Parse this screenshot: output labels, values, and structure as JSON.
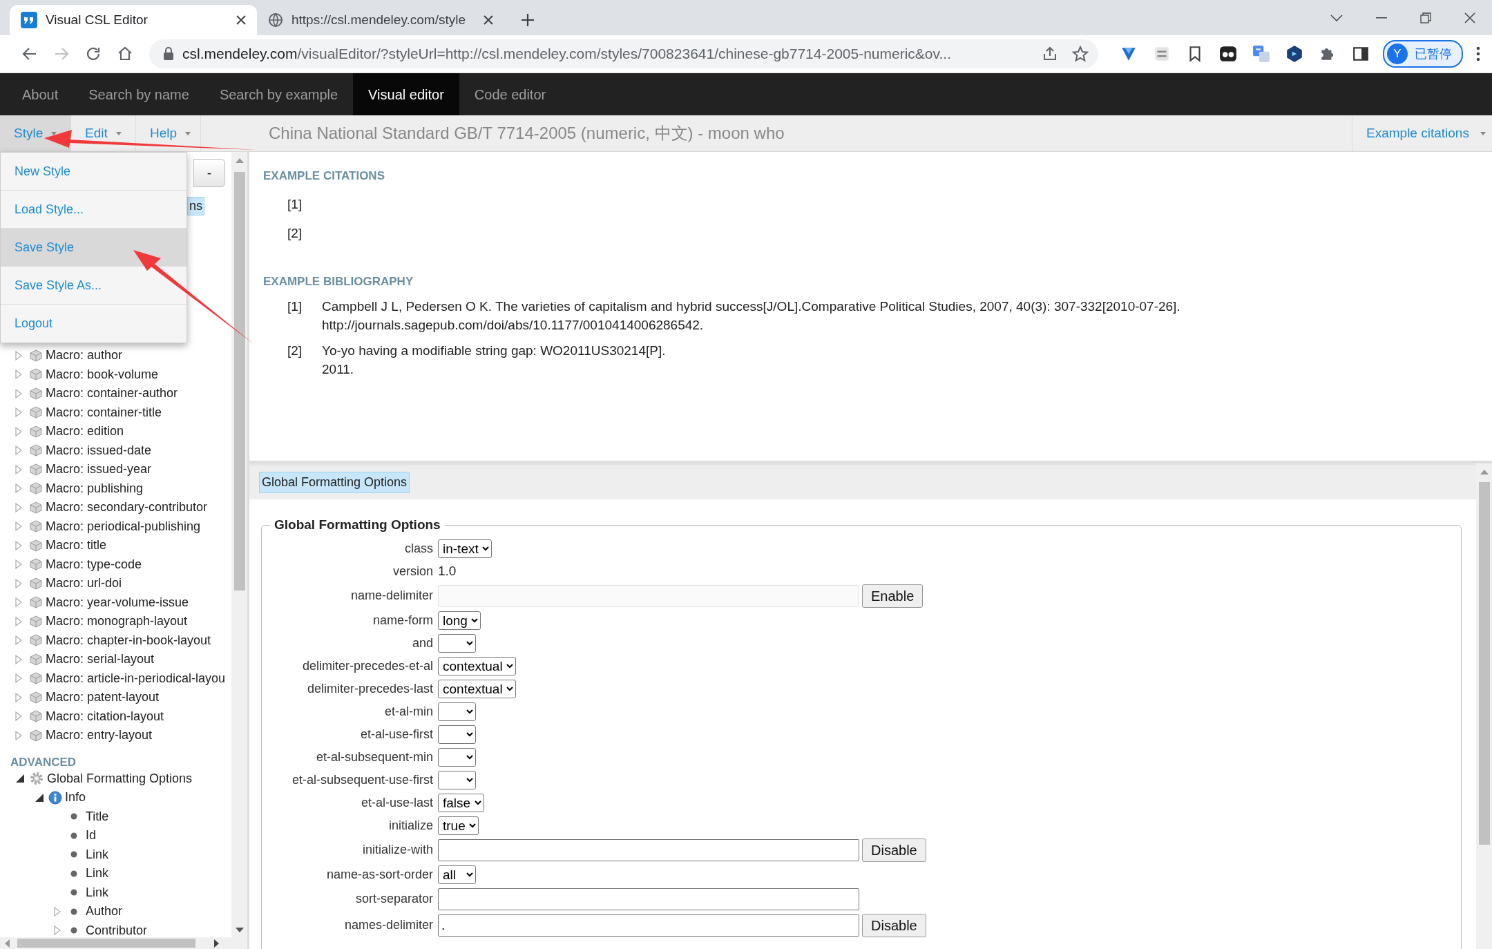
{
  "browser": {
    "tabs": [
      {
        "title": "Visual CSL Editor",
        "selected": true,
        "kind": "app"
      },
      {
        "title": "https://csl.mendeley.com/style",
        "selected": false,
        "kind": "globe"
      }
    ],
    "address": {
      "host": "csl.mendeley.com",
      "path": "/visualEditor/?styleUrl=http://csl.mendeley.com/styles/700823641/chinese-gb7714-2005-numeric&ov..."
    },
    "profile": {
      "initial": "Y",
      "status": "已暂停"
    }
  },
  "navbar": [
    {
      "label": "About",
      "selected": false
    },
    {
      "label": "Search by name",
      "selected": false
    },
    {
      "label": "Search by example",
      "selected": false
    },
    {
      "label": "Visual editor",
      "selected": true
    },
    {
      "label": "Code editor",
      "selected": false
    }
  ],
  "menubar": {
    "menus": [
      {
        "label": "Style",
        "selected": true
      },
      {
        "label": "Edit",
        "selected": false
      },
      {
        "label": "Help",
        "selected": false
      }
    ],
    "style_title": "China National Standard GB/T 7714-2005 (numeric, 中文) - moon who",
    "citations_menu": "Example citations"
  },
  "style_menu": [
    {
      "label": "New Style",
      "selected": false
    },
    {
      "label": "Load Style...",
      "selected": false
    },
    {
      "label": "Save Style",
      "selected": true
    },
    {
      "label": "Save Style As...",
      "selected": false
    },
    {
      "label": "Logout",
      "selected": false
    }
  ],
  "sidebar": {
    "toolbar_button": "-",
    "highlight_fragment": "ns",
    "macros": [
      {
        "label": "Macro: author",
        "expanded": false
      },
      {
        "label": "Macro: book-volume",
        "expanded": false
      },
      {
        "label": "Macro: container-author",
        "expanded": false
      },
      {
        "label": "Macro: container-title",
        "expanded": false
      },
      {
        "label": "Macro: edition",
        "expanded": false
      },
      {
        "label": "Macro: issued-date",
        "expanded": false
      },
      {
        "label": "Macro: issued-year",
        "expanded": false
      },
      {
        "label": "Macro: publishing",
        "expanded": false
      },
      {
        "label": "Macro: secondary-contributor",
        "expanded": false
      },
      {
        "label": "Macro: periodical-publishing",
        "expanded": false
      },
      {
        "label": "Macro: title",
        "expanded": false
      },
      {
        "label": "Macro: type-code",
        "expanded": false
      },
      {
        "label": "Macro: url-doi",
        "expanded": false
      },
      {
        "label": "Macro: year-volume-issue",
        "expanded": false
      },
      {
        "label": "Macro: monograph-layout",
        "expanded": false
      },
      {
        "label": "Macro: chapter-in-book-layout",
        "expanded": false
      },
      {
        "label": "Macro: serial-layout",
        "expanded": false
      },
      {
        "label": "Macro: article-in-periodical-layou",
        "expanded": false
      },
      {
        "label": "Macro: patent-layout",
        "expanded": false
      },
      {
        "label": "Macro: citation-layout",
        "expanded": false
      },
      {
        "label": "Macro: entry-layout",
        "expanded": false
      }
    ],
    "section": "ADVANCED",
    "tree": [
      {
        "label": "Global Formatting Options",
        "kind": "gear",
        "expanded": true,
        "children": [
          {
            "label": "Info",
            "kind": "info",
            "expanded": true,
            "children": [
              {
                "label": "Title",
                "kind": "dot"
              },
              {
                "label": "Id",
                "kind": "dot"
              },
              {
                "label": "Link",
                "kind": "dot"
              },
              {
                "label": "Link",
                "kind": "dot"
              },
              {
                "label": "Link",
                "kind": "dot"
              },
              {
                "label": "Author",
                "kind": "dot",
                "expanded": false
              },
              {
                "label": "Contributor",
                "kind": "dot",
                "expanded": false
              }
            ]
          }
        ]
      }
    ]
  },
  "examples": {
    "citations_heading": "EXAMPLE CITATIONS",
    "citations": [
      "[1]",
      "[2]"
    ],
    "bibliography_heading": "EXAMPLE BIBLIOGRAPHY",
    "bibliography": [
      {
        "number": "[1]",
        "lines": [
          "Campbell J L, Pedersen O K. The varieties of capitalism and hybrid success[J/OL].Comparative Political Studies, 2007, 40(3): 307-332[2010-07-26].",
          "http://journals.sagepub.com/doi/abs/10.1177/0010414006286542."
        ]
      },
      {
        "number": "[2]",
        "lines": [
          "Yo-yo having a modifiable string gap: WO2011US30214[P].",
          "2011."
        ]
      }
    ]
  },
  "form": {
    "tab": "Global Formatting Options",
    "legend": "Global Formatting Options",
    "fields": [
      {
        "label": "class",
        "kind": "select",
        "value": "in-text"
      },
      {
        "label": "version",
        "kind": "text",
        "value": "1.0"
      },
      {
        "label": "name-delimiter",
        "kind": "input",
        "disabled": true,
        "button": "Enable"
      },
      {
        "label": "name-form",
        "kind": "select",
        "value": "long"
      },
      {
        "label": "and",
        "kind": "select"
      },
      {
        "label": "delimiter-precedes-et-al",
        "kind": "select",
        "value": "contextual"
      },
      {
        "label": "delimiter-precedes-last",
        "kind": "select",
        "value": "contextual"
      },
      {
        "label": "et-al-min",
        "kind": "select"
      },
      {
        "label": "et-al-use-first",
        "kind": "select"
      },
      {
        "label": "et-al-subsequent-min",
        "kind": "select"
      },
      {
        "label": "et-al-subsequent-use-first",
        "kind": "select"
      },
      {
        "label": "et-al-use-last",
        "kind": "select",
        "value": "false"
      },
      {
        "label": "initialize",
        "kind": "select",
        "value": "true"
      },
      {
        "label": "initialize-with",
        "kind": "input",
        "disabled": false,
        "button": "Disable"
      },
      {
        "label": "name-as-sort-order",
        "kind": "select",
        "value": "all"
      },
      {
        "label": "sort-separator",
        "kind": "input",
        "disabled": false
      },
      {
        "label": "names-delimiter",
        "kind": "input",
        "disabled": false,
        "value": ".",
        "button": "Disable"
      }
    ]
  }
}
